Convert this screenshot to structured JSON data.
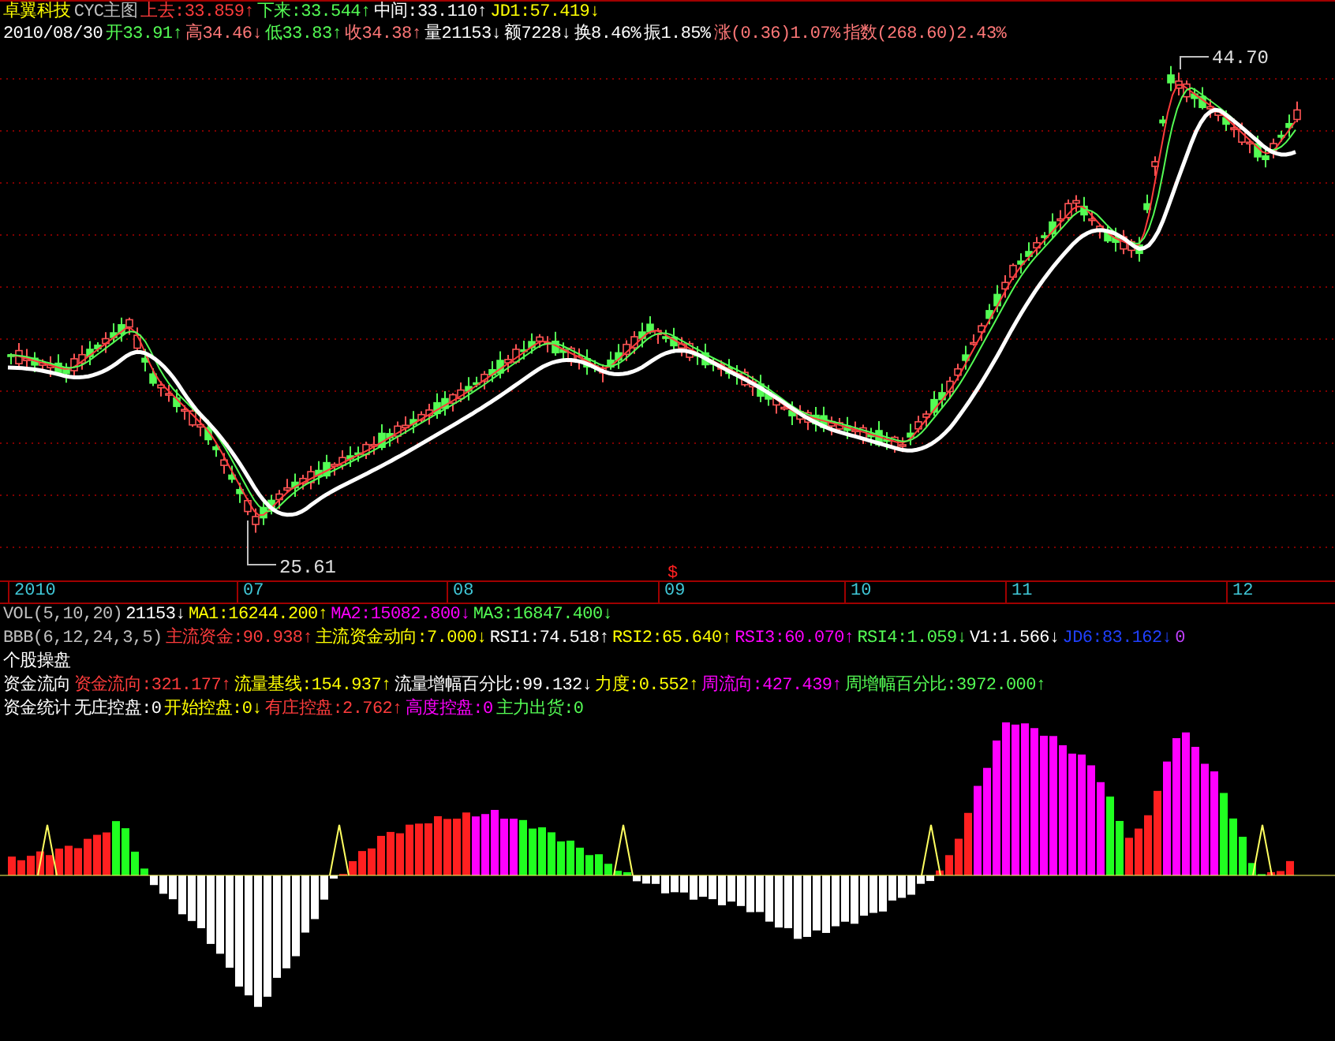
{
  "header_rows": [
    [
      {
        "text": "卓翼科技",
        "color": "#ffff00"
      },
      {
        "text": "CYC主图",
        "color": "#c0c0c0"
      },
      {
        "text": "上去:33.859↑",
        "color": "#ff3c3c"
      },
      {
        "text": "下来:33.544↑",
        "color": "#54fc54"
      },
      {
        "text": "中间:33.110↑",
        "color": "#ffffff"
      },
      {
        "text": "JD1:57.419↓",
        "color": "#ffff00"
      }
    ],
    [
      {
        "text": "2010/08/30",
        "color": "#ffffff"
      },
      {
        "text": "开33.91↑",
        "color": "#54fc54"
      },
      {
        "text": "高34.46↓",
        "color": "#ff7878"
      },
      {
        "text": "低33.83↑",
        "color": "#54fc54"
      },
      {
        "text": "收34.38↑",
        "color": "#ff7878"
      },
      {
        "text": "量21153↓",
        "color": "#ffffff"
      },
      {
        "text": "额7228↓",
        "color": "#ffffff"
      },
      {
        "text": "换8.46%",
        "color": "#ffffff"
      },
      {
        "text": "振1.85%",
        "color": "#ffffff"
      },
      {
        "text": "涨(0.36)1.07%",
        "color": "#ff7878"
      },
      {
        "text": "指数(268.60)2.43%",
        "color": "#ff7878"
      }
    ]
  ],
  "price_chart": {
    "high_label": "44.70",
    "low_label": "25.61",
    "signal_mark": "$"
  },
  "time_axis": [
    "2010",
    "07",
    "08",
    "09",
    "10",
    "11",
    "12"
  ],
  "indicator_rows": [
    [
      {
        "text": "VOL(5,10,20)",
        "color": "#c0c0c0"
      },
      {
        "text": "21153↓",
        "color": "#ffffff"
      },
      {
        "text": "MA1:16244.200↑",
        "color": "#ffff00"
      },
      {
        "text": "MA2:15082.800↓",
        "color": "#ff00ff"
      },
      {
        "text": "MA3:16847.400↓",
        "color": "#54fc54"
      }
    ],
    [
      {
        "text": "BBB(6,12,24,3,5)",
        "color": "#c0c0c0"
      },
      {
        "text": "主流资金:90.938↑",
        "color": "#ff3c3c"
      },
      {
        "text": "主流资金动向:7.000↓",
        "color": "#ffff00"
      },
      {
        "text": "RSI1:74.518↑",
        "color": "#ffffff"
      },
      {
        "text": "RSI2:65.640↑",
        "color": "#ffff00"
      },
      {
        "text": "RSI3:60.070↑",
        "color": "#ff00ff"
      },
      {
        "text": "RSI4:1.059↓",
        "color": "#54fc54"
      },
      {
        "text": "V1:1.566↓",
        "color": "#ffffff"
      },
      {
        "text": "JD6:83.162↓",
        "color": "#2040ff"
      },
      {
        "text": "0",
        "color": "#c040ff"
      }
    ],
    [
      {
        "text": "个股操盘",
        "color": "#ffffff"
      }
    ],
    [
      {
        "text": "资金流向",
        "color": "#ffffff"
      },
      {
        "text": "资金流向:321.177↑",
        "color": "#ff3c3c"
      },
      {
        "text": "流量基线:154.937↑",
        "color": "#ffff00"
      },
      {
        "text": "流量增幅百分比:99.132↓",
        "color": "#ffffff"
      },
      {
        "text": "力度:0.552↑",
        "color": "#ffff00"
      },
      {
        "text": "周流向:427.439↑",
        "color": "#ff00ff"
      },
      {
        "text": "周增幅百分比:3972.000↑",
        "color": "#54fc54"
      }
    ],
    [
      {
        "text": "资金统计",
        "color": "#ffffff"
      },
      {
        "text": "无庄控盘:0",
        "color": "#ffffff"
      },
      {
        "text": "开始控盘:0↓",
        "color": "#ffff00"
      },
      {
        "text": "有庄控盘:2.762↑",
        "color": "#ff3c3c"
      },
      {
        "text": "高度控盘:0",
        "color": "#ff00ff"
      },
      {
        "text": "主力出货:0",
        "color": "#54fc54"
      }
    ]
  ]
}
